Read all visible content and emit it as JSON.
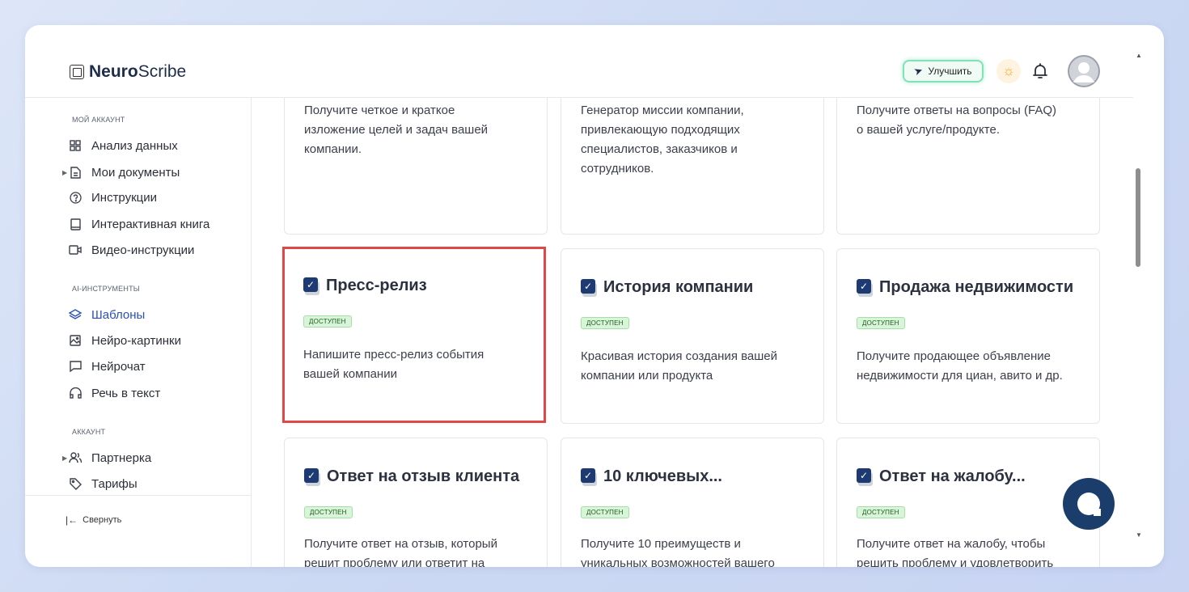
{
  "header": {
    "logo_bold": "Neuro",
    "logo_regular": "Scribe",
    "upgrade_label": "Улучшить"
  },
  "sidebar": {
    "sections": [
      {
        "title": "МОЙ АККАУНТ"
      },
      {
        "title": "AI-ИНСТРУМЕНТЫ"
      },
      {
        "title": "АККАУНТ"
      }
    ],
    "items": [
      {
        "label": "Анализ данных",
        "icon": "grid-icon"
      },
      {
        "label": "Мои документы",
        "icon": "document-icon"
      },
      {
        "label": "Инструкции",
        "icon": "help-icon"
      },
      {
        "label": "Интерактивная книга",
        "icon": "book-icon"
      },
      {
        "label": "Видео-инструкции",
        "icon": "video-icon"
      },
      {
        "label": "Шаблоны",
        "icon": "layers-icon"
      },
      {
        "label": "Нейро-картинки",
        "icon": "image-icon"
      },
      {
        "label": "Нейрочат",
        "icon": "chat-icon"
      },
      {
        "label": "Речь в текст",
        "icon": "headphones-icon"
      },
      {
        "label": "Партнерка",
        "icon": "users-icon"
      },
      {
        "label": "Тарифы",
        "icon": "tag-icon"
      }
    ],
    "collapse_label": "Свернуть"
  },
  "cards": [
    {
      "desc": [
        "Получите четкое и краткое",
        "изложение целей и задач вашей",
        "компании."
      ]
    },
    {
      "desc": [
        "Генератор миссии компании,",
        "привлекающую подходящих",
        "специалистов, заказчиков и",
        "сотрудников."
      ]
    },
    {
      "desc": [
        "Получите ответы на вопросы (FAQ)",
        "о вашей услуге/продукте."
      ]
    },
    {
      "title": "Пресс-релиз",
      "badge": "ДОСТУПЕН",
      "desc": [
        "Напишите пресс-релиз события",
        "вашей компании"
      ]
    },
    {
      "title": "История компании",
      "badge": "ДОСТУПЕН",
      "desc": [
        "Красивая история создания вашей",
        "компании или продукта"
      ]
    },
    {
      "title": "Продажа недвижимости",
      "badge": "ДОСТУПЕН",
      "desc": [
        "Получите продающее объявление",
        "недвижимости для циан, авито и др."
      ]
    },
    {
      "title": "Ответ на отзыв клиента",
      "badge": "ДОСТУПЕН",
      "desc": [
        "Получите ответ на отзыв, который",
        "решит проблему или ответит на"
      ]
    },
    {
      "title": "10 ключевых...",
      "badge": "ДОСТУПЕН",
      "desc": [
        "Получите 10 преимуществ и",
        "уникальных возможностей вашего"
      ]
    },
    {
      "title": "Ответ на жалобу...",
      "badge": "ДОСТУПЕН",
      "desc": [
        "Получите ответ на жалобу, чтобы",
        "решить проблему и удовлетворить"
      ]
    }
  ],
  "colors": {
    "accent": "#2a4fb5",
    "highlight_border": "#e04848",
    "badge_bg": "#d9f5d9",
    "chat_button": "#1a3d6b"
  }
}
